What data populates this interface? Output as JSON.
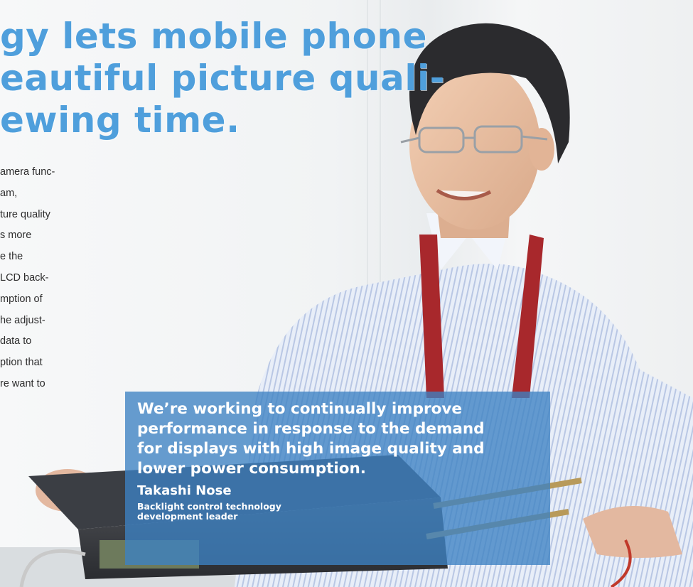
{
  "headline": {
    "line1": "gy lets mobile phone",
    "line2": "eautiful picture quali-",
    "line3": "ewing time."
  },
  "body_lines": [
    "amera func-",
    "am,",
    "ture quality",
    "s more",
    "e the",
    "LCD back-",
    "mption of",
    "he adjust-",
    "data to",
    "ption that",
    "re want to"
  ],
  "quote": {
    "line1": "We’re working to continually improve",
    "line2": "performance in response to the demand",
    "line3": "for displays with high image quality and",
    "line4": "lower power consumption."
  },
  "person": {
    "name": "Takashi Nose",
    "role_line1": "Backlight control technology",
    "role_line2": "development leader"
  },
  "colors": {
    "headline": "#4f9fdc",
    "quote_box": "#3c82c3",
    "shirt": "#dfe6f3",
    "lanyard": "#a8282c"
  }
}
